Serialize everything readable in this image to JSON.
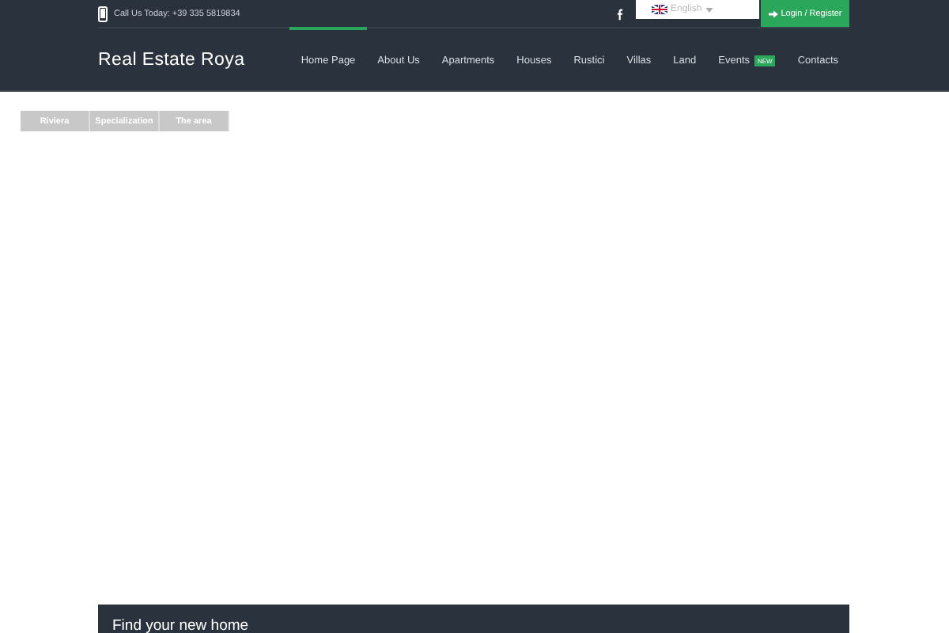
{
  "topbar": {
    "phone": "Call Us Today: +39 335 5819834",
    "language": "English",
    "login": "Login / Register"
  },
  "header": {
    "logo": "Real Estate Roya"
  },
  "nav": [
    {
      "label": "Home Page",
      "selected": true
    },
    {
      "label": "About Us",
      "selected": false
    },
    {
      "label": "Apartments",
      "selected": false
    },
    {
      "label": "Houses",
      "selected": false
    },
    {
      "label": "Rustici",
      "selected": false
    },
    {
      "label": "Villas",
      "selected": false
    },
    {
      "label": "Land",
      "selected": false
    },
    {
      "label": "Events",
      "selected": false,
      "badge": "NEW"
    },
    {
      "label": "Contacts",
      "selected": false
    }
  ],
  "tabs": [
    {
      "label": "Riviera"
    },
    {
      "label": "Specialization"
    },
    {
      "label": "The area"
    }
  ],
  "search_panel": {
    "title": "Find your new home"
  }
}
